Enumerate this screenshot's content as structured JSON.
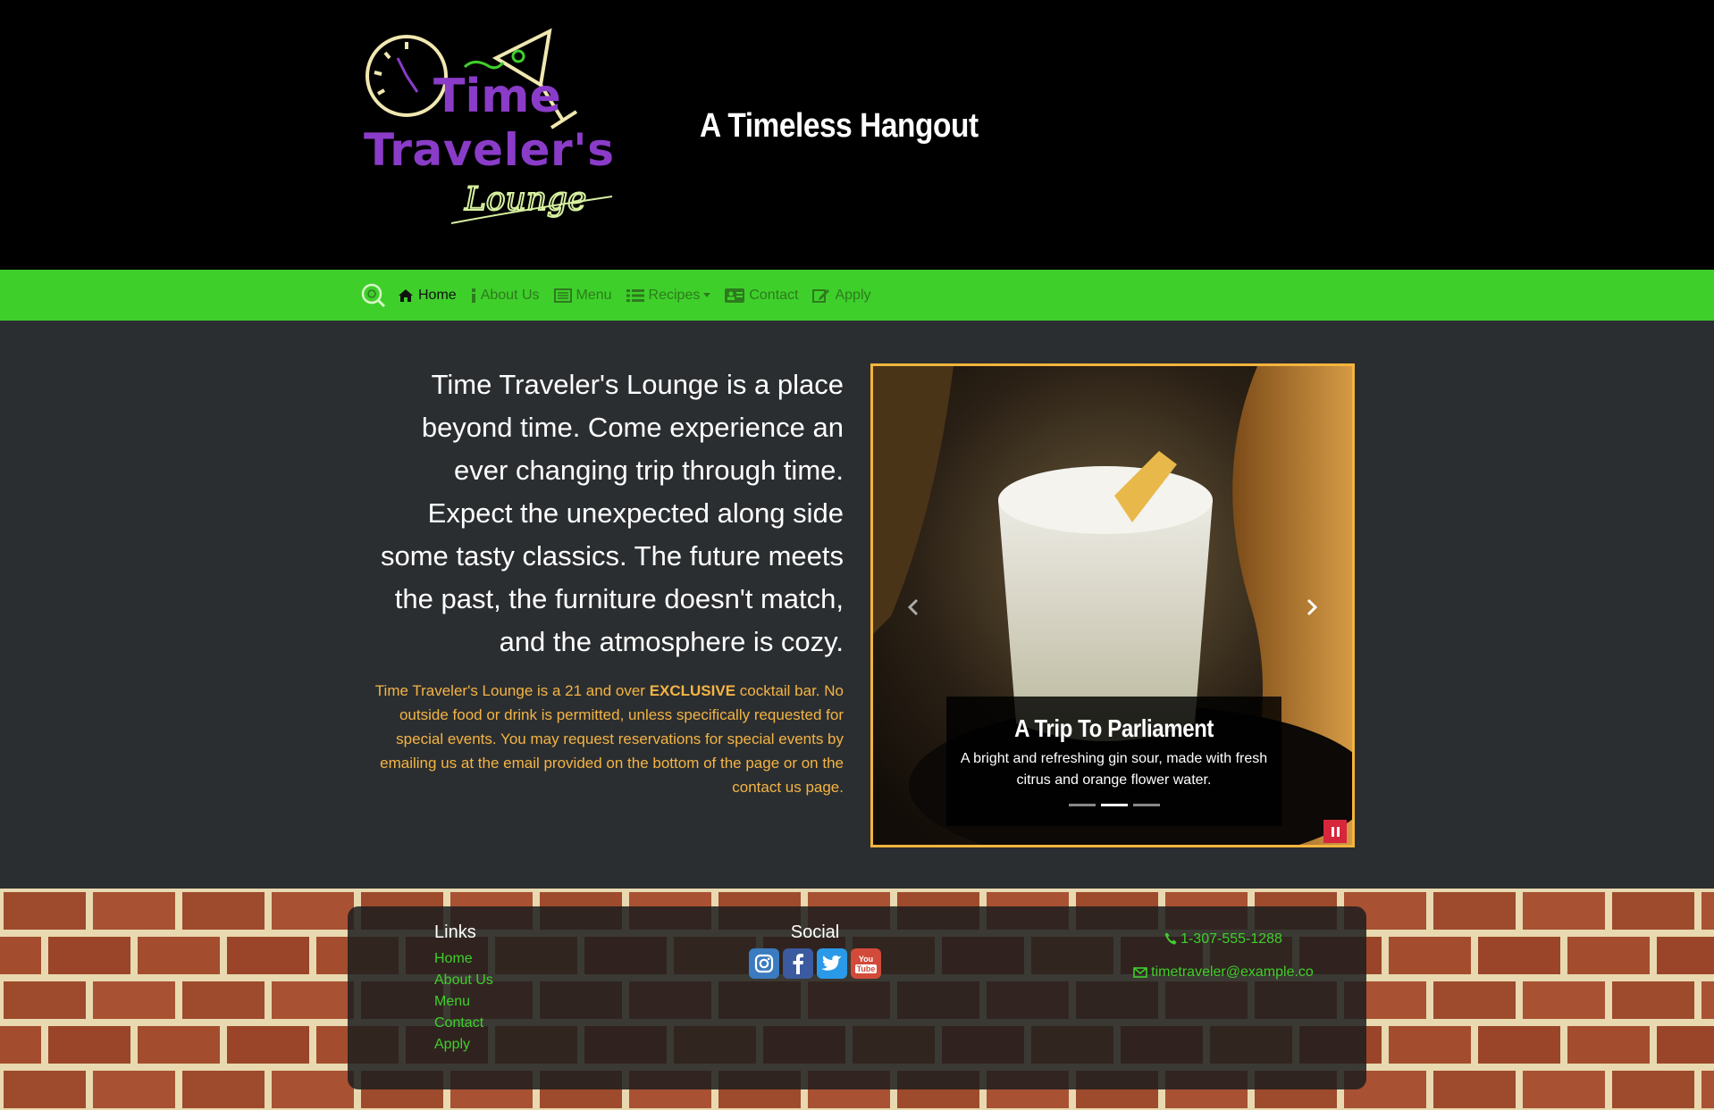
{
  "header": {
    "logo_line1": "Time",
    "logo_line2": "Traveler's",
    "logo_line3": "Lounge",
    "tagline": "A Timeless Hangout"
  },
  "nav": {
    "items": [
      {
        "label": "Home",
        "icon": "home-icon",
        "active": true
      },
      {
        "label": "About Us",
        "icon": "info-icon",
        "active": false
      },
      {
        "label": "Menu",
        "icon": "list-alt-icon",
        "active": false
      },
      {
        "label": "Recipes",
        "icon": "list-icon",
        "active": false,
        "dropdown": true
      },
      {
        "label": "Contact",
        "icon": "address-card-icon",
        "active": false
      },
      {
        "label": "Apply",
        "icon": "edit-icon",
        "active": false
      }
    ]
  },
  "main": {
    "intro": "Time Traveler's Lounge is a place beyond time. Come experience an ever changing trip through time. Expect the unexpected along side some tasty classics. The future meets the past, the furniture doesn't match, and the atmosphere is cozy.",
    "notice_part1": "Time Traveler's Lounge is a 21 and over ",
    "notice_bold": "EXCLUSIVE",
    "notice_part2": " cocktail bar. No outside food or drink is permitted, unless specifically requested for special events. You may request reservations for special events by emailing us at the email provided on the bottom of the page or on the contact us page."
  },
  "carousel": {
    "caption_title": "A Trip To Parliament",
    "caption_text": "A bright and refreshing gin sour, made with fresh citrus and orange flower water.",
    "slide_count": 3,
    "active_index": 1
  },
  "footer": {
    "links_heading": "Links",
    "links": [
      "Home",
      "About Us",
      "Menu",
      "Contact",
      "Apply"
    ],
    "social_heading": "Social",
    "social": [
      "instagram-icon",
      "facebook-icon",
      "twitter-icon",
      "youtube-icon"
    ],
    "youtube_text_1": "You",
    "youtube_text_2": "Tube",
    "phone": "1-307-555-1288",
    "email": "timetraveler@example.co"
  },
  "colors": {
    "nav_green": "#3fcf2b",
    "accent_orange": "#f4b445",
    "logo_purple": "#8a3cc8",
    "pause_red": "#d6263c"
  }
}
